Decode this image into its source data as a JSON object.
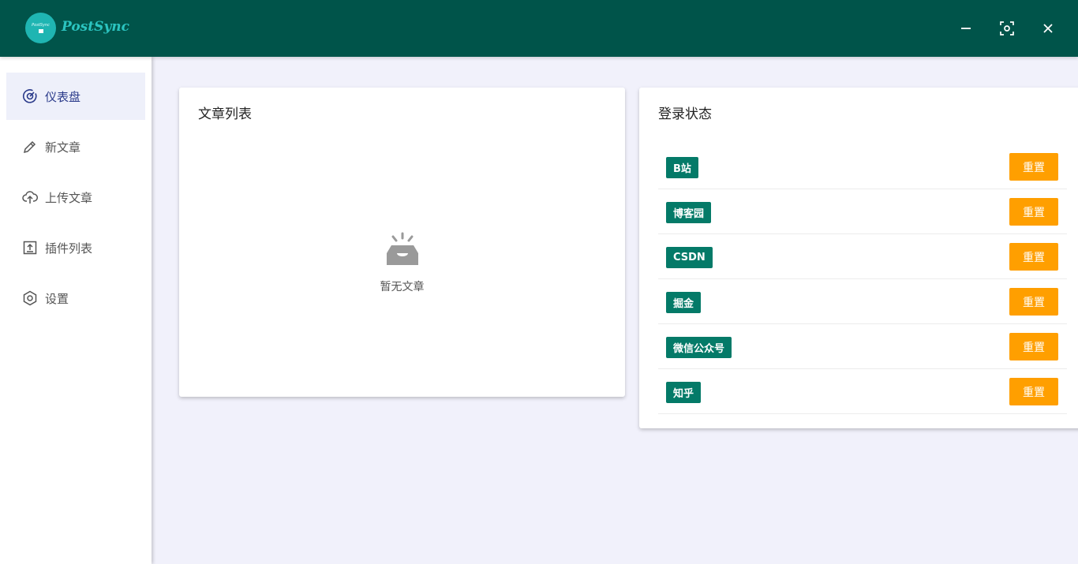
{
  "app": {
    "logo_mini_text": "PostSync",
    "name": "PostSync"
  },
  "window_controls": [
    {
      "name": "minimize-icon"
    },
    {
      "name": "fullscreen-icon"
    },
    {
      "name": "close-icon"
    }
  ],
  "sidebar": {
    "items": [
      {
        "label": "仪表盘",
        "icon": "dashboard-gauge-icon",
        "active": true
      },
      {
        "label": "新文章",
        "icon": "pencil-icon",
        "active": false
      },
      {
        "label": "上传文章",
        "icon": "cloud-upload-icon",
        "active": false
      },
      {
        "label": "插件列表",
        "icon": "upload-box-icon",
        "active": false
      },
      {
        "label": "设置",
        "icon": "hexagon-settings-icon",
        "active": false
      }
    ]
  },
  "article_card": {
    "title": "文章列表",
    "empty_text": "暂无文章",
    "empty_icon": "empty-inbox-icon"
  },
  "login_card": {
    "title": "登录状态",
    "platforms": [
      {
        "name": "B站",
        "action": "重置"
      },
      {
        "name": "博客园",
        "action": "重置"
      },
      {
        "name": "CSDN",
        "action": "重置"
      },
      {
        "name": "掘金",
        "action": "重置"
      },
      {
        "name": "微信公众号",
        "action": "重置"
      },
      {
        "name": "知乎",
        "action": "重置"
      }
    ]
  },
  "colors": {
    "titlebar": "#00544a",
    "logo": "#1fb5b2",
    "tag": "#047a68",
    "reset_button": "#ff9f00",
    "background": "#f1f1fb"
  }
}
